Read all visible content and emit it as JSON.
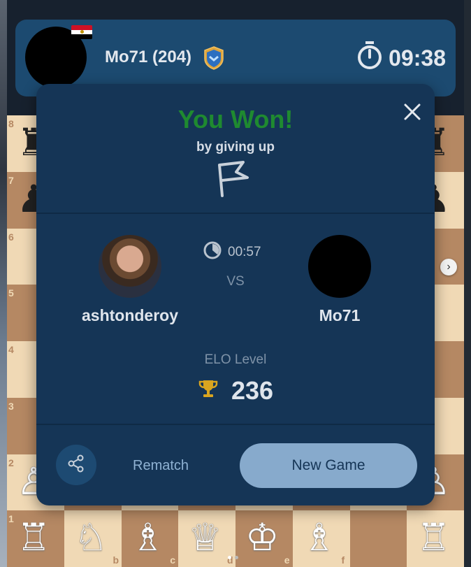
{
  "colors": {
    "light_square": "#f0d9b5",
    "dark_square": "#b58863",
    "modal_bg": "#153556",
    "win_green": "#1f8a30",
    "button_primary": "#87aacc",
    "trophy": "#d9a520"
  },
  "opponent_bar": {
    "name": "Mo71 (204)",
    "clock": "09:38",
    "flag": "egypt-flag-icon",
    "badge": "shield-rank-icon"
  },
  "board": {
    "ranks": [
      "8",
      "7",
      "6",
      "5",
      "4",
      "3",
      "2",
      "1"
    ],
    "files": [
      "b",
      "c",
      "d",
      "e",
      "f"
    ]
  },
  "result_modal": {
    "title": "You Won!",
    "reason": "by giving up",
    "game_time": "00:57",
    "vs_label": "VS",
    "player_left": {
      "name": "ashtonderoy"
    },
    "player_right": {
      "name": "Mo71"
    },
    "elo_label": "ELO Level",
    "elo_value": "236",
    "rematch_label": "Rematch",
    "new_game_label": "New Game"
  }
}
